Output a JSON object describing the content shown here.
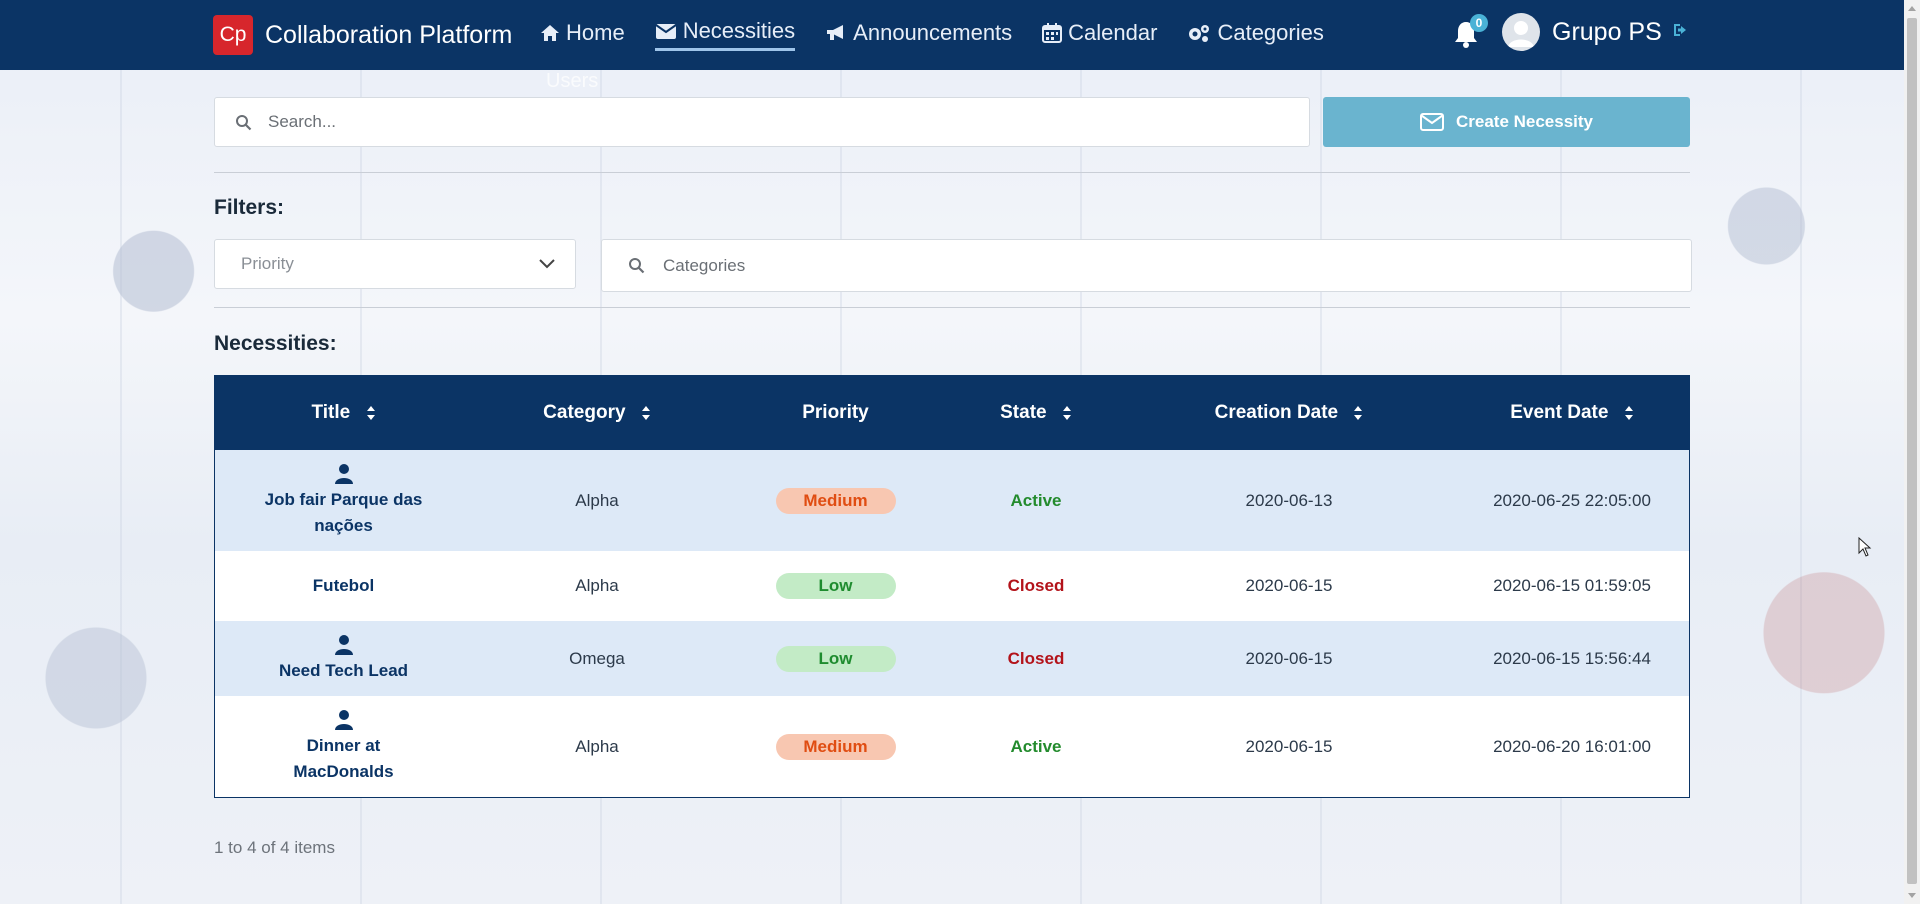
{
  "navbar": {
    "brand_logo": "Cp",
    "brand_name": "Collaboration Platform",
    "links": [
      {
        "label": "Home",
        "icon": "home-icon"
      },
      {
        "label": "Necessities",
        "icon": "envelope-icon",
        "active": true
      },
      {
        "label": "Announcements",
        "icon": "megaphone-icon"
      },
      {
        "label": "Calendar",
        "icon": "calendar-icon"
      },
      {
        "label": "Categories",
        "icon": "gears-icon"
      }
    ],
    "hidden_link": "Users",
    "notifications_count": "0",
    "user_name": "Grupo PS"
  },
  "search": {
    "placeholder": "Search..."
  },
  "create_button": {
    "label": "Create Necessity"
  },
  "filters": {
    "title": "Filters:",
    "priority_placeholder": "Priority",
    "categories_placeholder": "Categories"
  },
  "necessities": {
    "title": "Necessities:",
    "columns": [
      "Title",
      "Category",
      "Priority",
      "State",
      "Creation Date",
      "Event Date"
    ],
    "rows": [
      {
        "title": "Job fair Parque das nações",
        "has_person_icon": true,
        "category": "Alpha",
        "priority": "Medium",
        "state": "Active",
        "creation_date": "2020-06-13",
        "event_date": "2020-06-25 22:05:00"
      },
      {
        "title": "Futebol",
        "has_person_icon": false,
        "category": "Alpha",
        "priority": "Low",
        "state": "Closed",
        "creation_date": "2020-06-15",
        "event_date": "2020-06-15 01:59:05"
      },
      {
        "title": "Need Tech Lead",
        "has_person_icon": true,
        "category": "Omega",
        "priority": "Low",
        "state": "Closed",
        "creation_date": "2020-06-15",
        "event_date": "2020-06-15 15:56:44"
      },
      {
        "title": "Dinner at MacDonalds",
        "has_person_icon": true,
        "category": "Alpha",
        "priority": "Medium",
        "state": "Active",
        "creation_date": "2020-06-15",
        "event_date": "2020-06-20 16:01:00"
      }
    ]
  },
  "pagination": {
    "info": "1 to 4 of 4 items"
  },
  "colors": {
    "navbar": "#0b3465",
    "brand_logo": "#d7262c",
    "create_button": "#6ab4cf",
    "priority_medium": "#e04d12",
    "priority_low": "#1f8c2f",
    "state_active": "#238b2d",
    "state_closed": "#b3131a"
  }
}
